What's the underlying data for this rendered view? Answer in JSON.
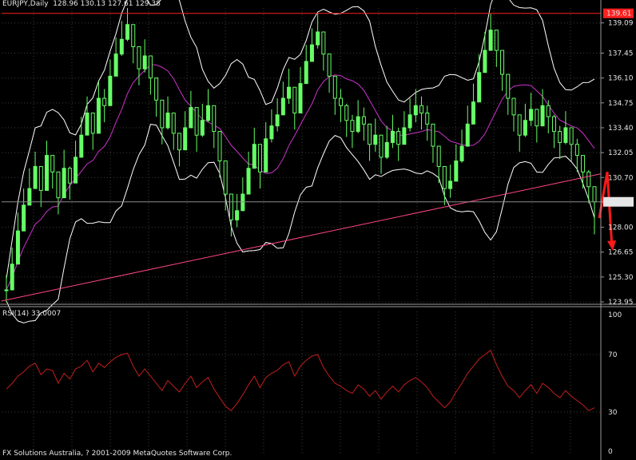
{
  "header": {
    "symbol": "EURJPY,Daily",
    "ohlc": "128.96 130.13 127.61 129.38"
  },
  "rsi_header": "RSI(14) 33.0007",
  "footer": "FX Solutions Australia, ? 2001-2009 MetaQuotes Software Corp.",
  "colors": {
    "background": "#000000",
    "grid": "#3c3c3c",
    "candles": "#66ff66",
    "bollinger": "#ffffff",
    "moving_average": "#cc33cc",
    "trendline": "#ff4488",
    "resistance": "#ff2020",
    "rsi": "#c41e1e",
    "arrow": "#ff1a1a"
  },
  "price_labels": {
    "resistance": "139.61",
    "current": "129.38"
  },
  "chart_data": [
    {
      "type": "line",
      "name": "price",
      "title": "EURJPY,Daily",
      "ylim": [
        123.95,
        139.9
      ],
      "y_ticks": [
        "139.09",
        "137.45",
        "136.10",
        "134.75",
        "133.40",
        "132.05",
        "130.70",
        "129.38",
        "128.00",
        "126.65",
        "125.30",
        "123.95"
      ],
      "resistance_level": 139.61,
      "current_price": 129.38,
      "close": [
        124.6,
        126.0,
        127.8,
        129.2,
        130.1,
        131.3,
        130.0,
        131.9,
        131.0,
        129.6,
        131.2,
        130.4,
        131.8,
        133.0,
        134.2,
        133.1,
        135.0,
        134.6,
        136.2,
        137.4,
        138.2,
        139.0,
        137.8,
        136.6,
        137.3,
        136.1,
        134.9,
        133.4,
        134.2,
        133.1,
        132.2,
        133.4,
        134.5,
        133.0,
        133.8,
        134.6,
        133.2,
        131.6,
        129.8,
        128.4,
        128.9,
        129.8,
        131.2,
        132.5,
        131.0,
        132.8,
        133.5,
        134.1,
        135.0,
        135.6,
        134.2,
        135.8,
        137.0,
        137.9,
        138.6,
        137.4,
        136.2,
        135.0,
        134.6,
        133.8,
        133.2,
        134.0,
        133.6,
        132.5,
        133.0,
        131.8,
        132.6,
        133.2,
        132.5,
        133.4,
        134.1,
        134.6,
        134.2,
        133.6,
        132.4,
        131.3,
        130.1,
        130.5,
        131.6,
        132.4,
        133.6,
        134.8,
        136.4,
        137.6,
        138.7,
        137.6,
        136.3,
        135.0,
        134.1,
        133.0,
        133.8,
        134.4,
        133.5,
        134.6,
        134.0,
        133.2,
        132.6,
        133.4,
        132.5,
        131.9,
        131.0,
        130.2,
        129.38
      ],
      "high": [
        125.4,
        126.9,
        128.8,
        130.1,
        131.2,
        132.1,
        131.2,
        132.7,
        131.9,
        130.6,
        132.2,
        131.3,
        132.7,
        134.0,
        135.1,
        134.0,
        135.9,
        135.5,
        137.1,
        138.3,
        139.2,
        139.9,
        138.8,
        137.6,
        138.2,
        137.0,
        135.8,
        134.3,
        135.1,
        134.0,
        133.1,
        134.3,
        135.4,
        133.9,
        134.7,
        135.5,
        134.1,
        132.5,
        130.8,
        129.4,
        129.8,
        130.7,
        132.1,
        133.4,
        131.9,
        133.7,
        134.4,
        135.0,
        135.9,
        136.6,
        135.1,
        136.7,
        137.9,
        138.8,
        139.6,
        138.4,
        137.1,
        135.9,
        135.5,
        134.7,
        134.1,
        134.9,
        134.5,
        133.4,
        133.9,
        132.8,
        133.5,
        134.1,
        133.4,
        134.3,
        135.0,
        135.5,
        135.1,
        134.6,
        133.3,
        132.2,
        131.0,
        131.4,
        132.5,
        133.3,
        134.6,
        135.8,
        137.4,
        138.6,
        139.6,
        138.6,
        137.3,
        135.9,
        135.0,
        133.9,
        134.7,
        135.3,
        134.4,
        135.5,
        134.9,
        134.1,
        133.5,
        134.3,
        133.4,
        132.8,
        131.9,
        131.1,
        130.13
      ],
      "low": [
        123.95,
        125.2,
        126.9,
        128.3,
        129.2,
        130.4,
        129.1,
        131.0,
        130.1,
        128.7,
        130.3,
        129.5,
        130.9,
        132.1,
        133.3,
        132.2,
        134.1,
        133.7,
        135.3,
        136.5,
        137.3,
        138.1,
        136.9,
        135.7,
        136.4,
        135.2,
        134.0,
        132.5,
        133.3,
        132.2,
        131.3,
        132.5,
        133.6,
        132.1,
        132.9,
        133.7,
        132.3,
        130.7,
        128.9,
        127.5,
        128.0,
        128.9,
        130.3,
        131.6,
        130.1,
        131.9,
        132.6,
        133.2,
        134.1,
        134.7,
        133.3,
        134.9,
        136.1,
        137.0,
        137.7,
        136.5,
        135.3,
        134.1,
        133.7,
        132.9,
        132.3,
        133.1,
        132.7,
        131.6,
        132.1,
        130.9,
        131.7,
        132.3,
        131.6,
        132.5,
        133.2,
        133.7,
        133.3,
        132.7,
        131.5,
        130.4,
        129.2,
        129.6,
        130.7,
        131.5,
        132.7,
        133.9,
        135.5,
        136.7,
        137.8,
        136.7,
        135.4,
        134.1,
        133.2,
        132.1,
        132.9,
        133.5,
        132.6,
        133.7,
        133.1,
        132.3,
        131.7,
        132.5,
        131.6,
        131.0,
        130.1,
        129.3,
        127.61
      ]
    },
    {
      "type": "line",
      "name": "RSI(14)",
      "title": "RSI(14) 33.0007",
      "ylim": [
        0,
        100
      ],
      "y_ticks": [
        "100",
        "70",
        "30",
        "0"
      ],
      "levels": [
        70,
        30
      ],
      "values": [
        46,
        50,
        55,
        58,
        62,
        64,
        56,
        60,
        59,
        50,
        57,
        53,
        60,
        62,
        66,
        58,
        64,
        61,
        65,
        68,
        70,
        71,
        62,
        55,
        60,
        55,
        50,
        45,
        52,
        48,
        44,
        50,
        55,
        47,
        51,
        54,
        46,
        40,
        34,
        31,
        36,
        42,
        49,
        55,
        47,
        54,
        57,
        59,
        63,
        65,
        55,
        62,
        66,
        69,
        70,
        61,
        55,
        50,
        48,
        45,
        43,
        49,
        46,
        41,
        45,
        39,
        44,
        48,
        44,
        49,
        52,
        54,
        51,
        47,
        41,
        37,
        33,
        37,
        44,
        50,
        57,
        62,
        67,
        70,
        73,
        63,
        55,
        48,
        45,
        40,
        45,
        49,
        43,
        50,
        47,
        43,
        40,
        45,
        41,
        38,
        35,
        31,
        33
      ]
    }
  ]
}
